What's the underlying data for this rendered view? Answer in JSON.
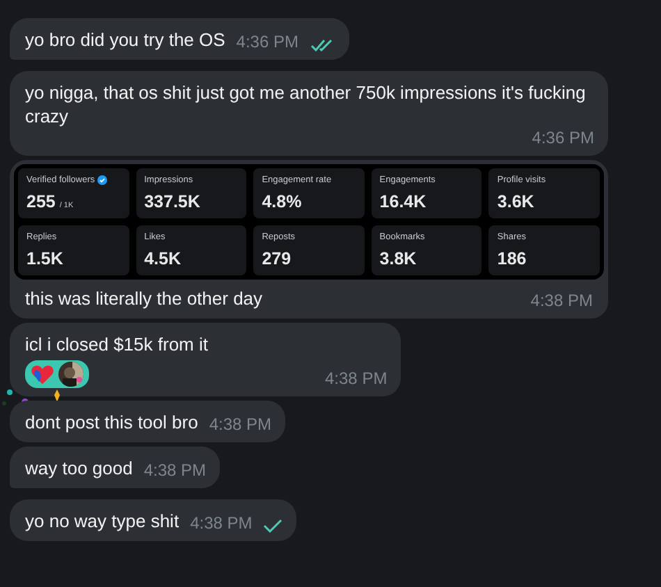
{
  "messages": [
    {
      "kind": "text",
      "text": "yo bro did you try the OS",
      "time": "4:36 PM",
      "read": true,
      "tail": true
    },
    {
      "kind": "text",
      "text": "yo nigga, that os shit just got me another 750k impressions it's fucking crazy",
      "time": "4:36 PM",
      "tail": false
    },
    {
      "kind": "stats",
      "caption": "this was literally the other day",
      "time": "4:38 PM",
      "tail": false,
      "stats": [
        {
          "label": "Verified followers",
          "value": "255",
          "suffix": "/ 1K",
          "verified": true
        },
        {
          "label": "Impressions",
          "value": "337.5K",
          "verified": false
        },
        {
          "label": "Engagement rate",
          "value": "4.8%",
          "verified": false
        },
        {
          "label": "Engagements",
          "value": "16.4K",
          "verified": false
        },
        {
          "label": "Profile visits",
          "value": "3.6K",
          "verified": false
        },
        {
          "label": "Replies",
          "value": "1.5K",
          "verified": false
        },
        {
          "label": "Likes",
          "value": "4.5K",
          "verified": false
        },
        {
          "label": "Reposts",
          "value": "279",
          "verified": false
        },
        {
          "label": "Bookmarks",
          "value": "3.8K",
          "verified": false
        },
        {
          "label": "Shares",
          "value": "186",
          "verified": false
        }
      ]
    },
    {
      "kind": "text",
      "text": "icl i closed $15k from it",
      "time": "4:38 PM",
      "tail": false,
      "reaction": true
    },
    {
      "kind": "text",
      "text": "dont post this tool bro",
      "time": "4:38 PM",
      "tail": false
    },
    {
      "kind": "text",
      "text": "way too good",
      "time": "4:38 PM",
      "tail": true
    },
    {
      "kind": "text",
      "text": "yo no way type shit",
      "time": "4:38 PM",
      "read": false,
      "tail": false
    }
  ]
}
